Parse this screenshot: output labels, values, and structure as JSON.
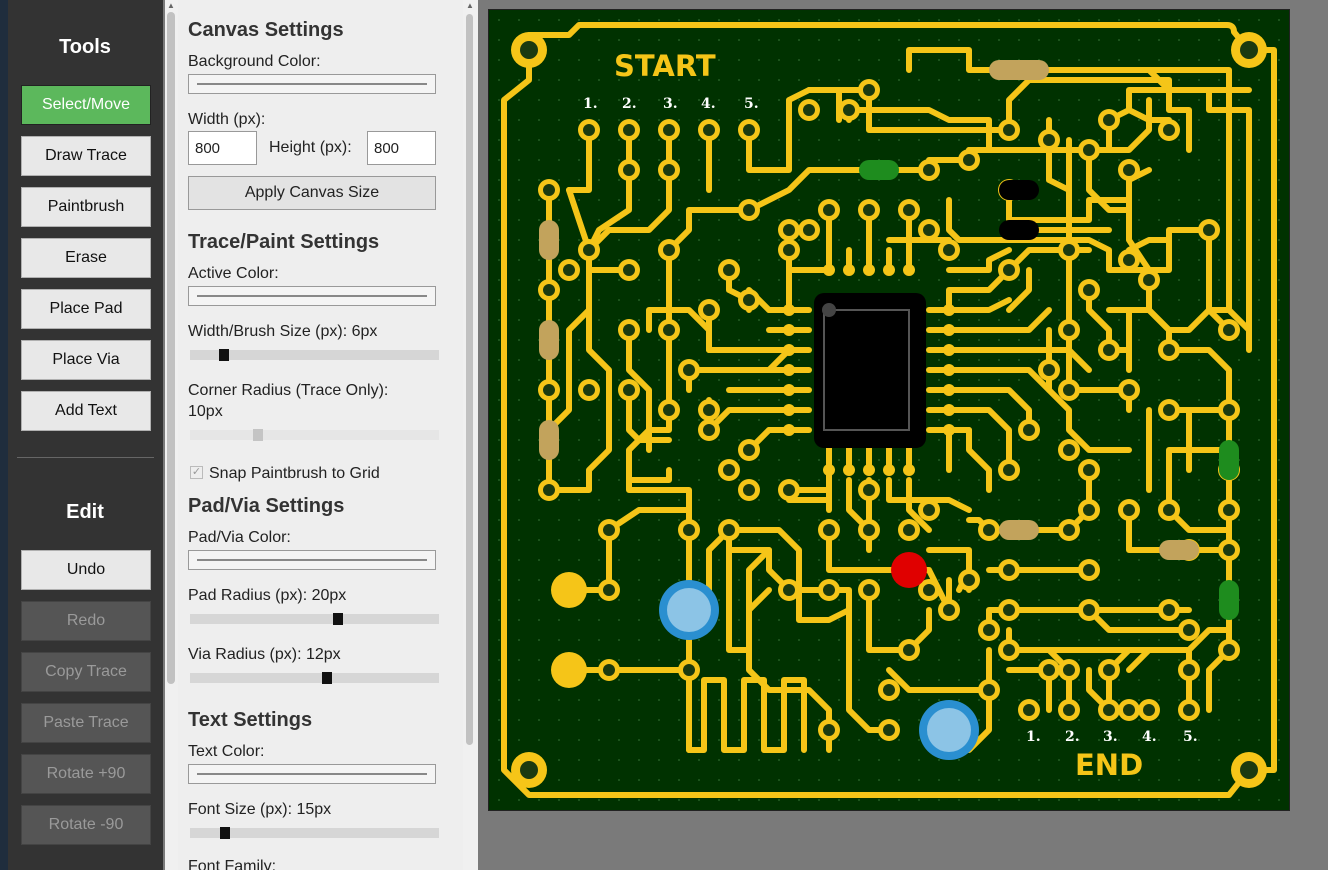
{
  "tools": {
    "heading": "Tools",
    "buttons": [
      "Select/Move",
      "Draw Trace",
      "Paintbrush",
      "Erase",
      "Place Pad",
      "Place Via",
      "Add Text"
    ],
    "active": "Select/Move"
  },
  "edit": {
    "heading": "Edit",
    "buttons": [
      "Undo",
      "Redo",
      "Copy Trace",
      "Paste Trace",
      "Rotate +90",
      "Rotate -90"
    ],
    "disabled": [
      "Redo",
      "Copy Trace",
      "Paste Trace",
      "Rotate +90",
      "Rotate -90"
    ]
  },
  "canvas_settings": {
    "heading": "Canvas Settings",
    "bg_label": "Background Color:",
    "width_label": "Width (px):",
    "width_value": "800",
    "height_label": "Height (px):",
    "height_value": "800",
    "apply_label": "Apply Canvas Size"
  },
  "trace_settings": {
    "heading": "Trace/Paint Settings",
    "color_label": "Active Color:",
    "width_label": "Width/Brush Size (px): 6px",
    "width_value": 6,
    "radius_label_1": "Corner Radius (Trace Only):",
    "radius_label_2": "10px",
    "radius_value": 10,
    "snap_label": "Snap Paintbrush to Grid",
    "snap_checked": true
  },
  "pad_settings": {
    "heading": "Pad/Via Settings",
    "color_label": "Pad/Via Color:",
    "pad_radius_label": "Pad Radius (px): 20px",
    "pad_radius_value": 20,
    "via_radius_label": "Via Radius (px): 12px",
    "via_radius_value": 12
  },
  "text_settings": {
    "heading": "Text Settings",
    "color_label": "Text Color:",
    "font_size_label": "Font Size (px): 15px",
    "font_size_value": 15,
    "font_family_label": "Font Family:"
  },
  "board": {
    "start_label": "START",
    "end_label": "END",
    "top_numbers": [
      "1.",
      "2.",
      "3.",
      "4.",
      "5."
    ],
    "bottom_numbers": [
      "1.",
      "2.",
      "3.",
      "4.",
      "5."
    ],
    "colors": {
      "background": "#003200",
      "trace": "#f5c518",
      "via_hole": "#1a3a10",
      "resistor_tan": "#c2a35c",
      "resistor_green": "#1e8c1e",
      "resistor_black": "#000000",
      "chip": "#000000",
      "led_red": "#e00000",
      "pad_yellow": "#f5c518",
      "button_blue": "#2a8fd0",
      "button_light": "#8cc4e6",
      "label_white": "#ffffff"
    }
  }
}
